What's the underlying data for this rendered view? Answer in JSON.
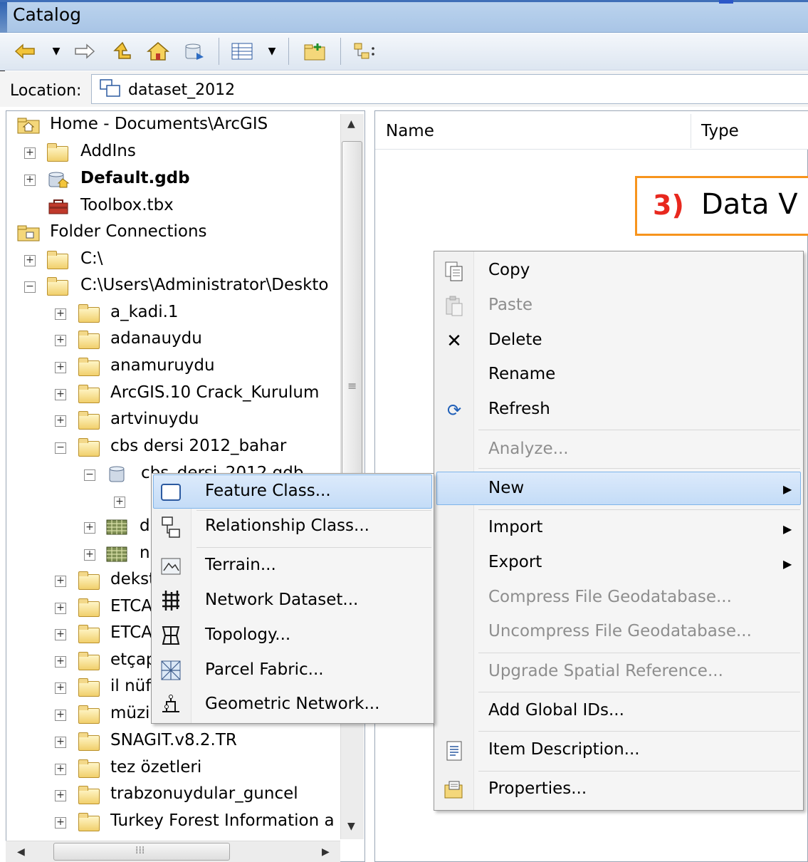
{
  "window": {
    "title": "Catalog"
  },
  "toolbar": {
    "buttons": [
      "back-icon",
      "back-dropdown-icon",
      "forward-icon",
      "up-one-level-icon",
      "home-icon",
      "connect-icon",
      "views-icon",
      "views-dropdown-icon",
      "new-folder-icon",
      "tree-toggle-icon"
    ]
  },
  "location": {
    "label": "Location:",
    "value": "dataset_2012"
  },
  "tree": {
    "home": "Home - Documents\\ArcGIS",
    "addins": "AddIns",
    "default_gdb": "Default.gdb",
    "toolbox": "Toolbox.tbx",
    "folder_connections": "Folder Connections",
    "c_drive": "C:\\",
    "desktop_path": "C:\\Users\\Administrator\\Deskto",
    "folders": [
      "a_kadi.1",
      "adanauydu",
      "anamuruydu",
      "ArcGIS.10 Crack_Kurulum",
      "artvinuydu",
      "cbs dersi 2012_bahar"
    ],
    "gdb_partial": "cbs_dersi_2012.gdb",
    "d_partial": "d",
    "n_partial": "n",
    "folders_lower": [
      "dekst",
      "ETCA",
      "ETCA",
      "etçap",
      "il nüf",
      "müzi",
      "SNAGIT.v8.2.TR",
      "tez özetleri",
      "trabzonuydular_guncel",
      "Turkey Forest Information a"
    ]
  },
  "content": {
    "col_name": "Name",
    "col_type": "Type"
  },
  "annotation": {
    "number": "3)",
    "text": "Data V"
  },
  "context_menu": {
    "copy": "Copy",
    "paste": "Paste",
    "delete": "Delete",
    "rename": "Rename",
    "refresh": "Refresh",
    "analyze": "Analyze...",
    "new": "New",
    "import": "Import",
    "export": "Export",
    "compress": "Compress File Geodatabase...",
    "uncompress": "Uncompress File Geodatabase...",
    "upgrade": "Upgrade Spatial Reference...",
    "add_global_ids": "Add Global IDs...",
    "item_description": "Item Description...",
    "properties": "Properties..."
  },
  "new_submenu": {
    "feature_class": "Feature Class...",
    "relationship_class": "Relationship Class...",
    "terrain": "Terrain...",
    "network_dataset": "Network Dataset...",
    "topology": "Topology...",
    "parcel_fabric": "Parcel Fabric...",
    "geometric_network": "Geometric Network..."
  },
  "colors": {
    "highlight": "#c4dcf7",
    "highlight_border": "#7eb4ea",
    "annotation_border": "#f7941d",
    "annotation_number": "#e8281e"
  }
}
